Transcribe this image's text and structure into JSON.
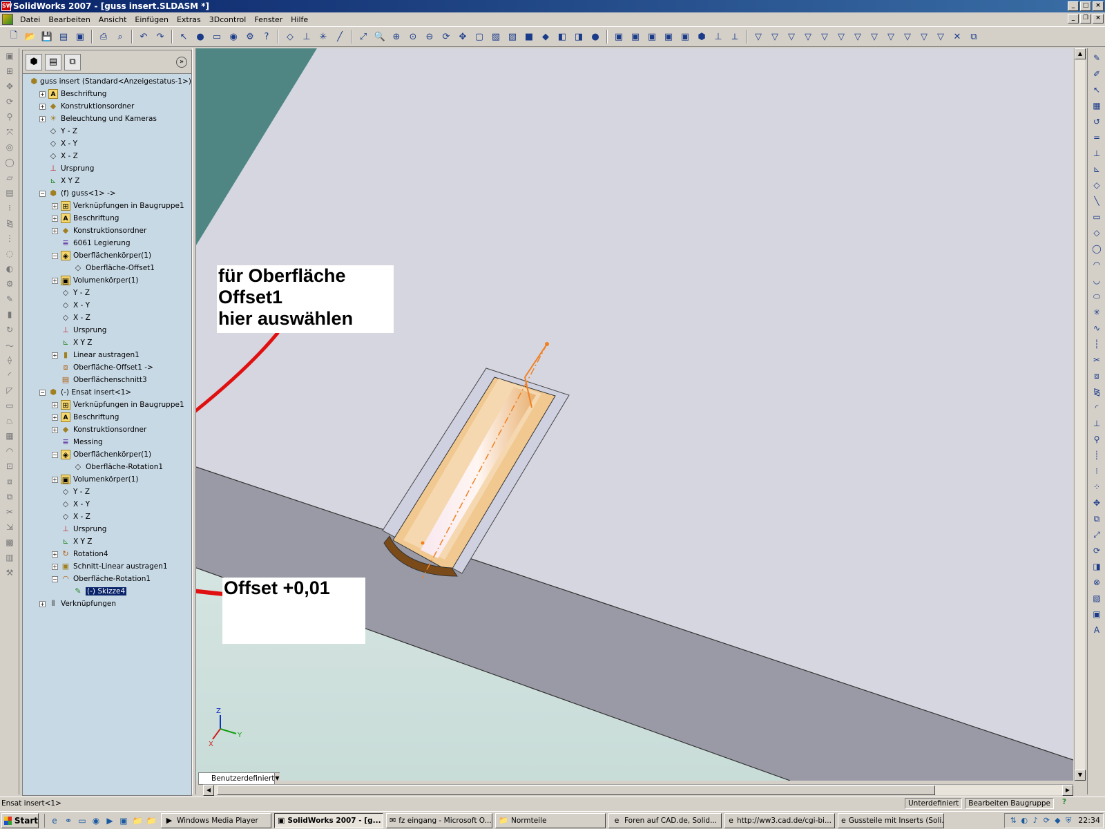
{
  "window": {
    "title": "SolidWorks 2007 - [guss insert.SLDASM *]",
    "app_icon_text": "SW"
  },
  "menu": [
    "Datei",
    "Bearbeiten",
    "Ansicht",
    "Einfügen",
    "Extras",
    "3Dcontrol",
    "Fenster",
    "Hilfe"
  ],
  "feature_tree": [
    {
      "label": "guss insert  (Standard<Anzeigestatus-1>)",
      "depth": 0,
      "toggle": "",
      "icon": "assembly-icon"
    },
    {
      "label": "Beschriftung",
      "depth": 1,
      "toggle": "+",
      "icon": "annotation-icon"
    },
    {
      "label": "Konstruktionsordner",
      "depth": 1,
      "toggle": "+",
      "icon": "design-folder-icon"
    },
    {
      "label": "Beleuchtung und Kameras",
      "depth": 1,
      "toggle": "+",
      "icon": "lights-icon"
    },
    {
      "label": "Y - Z",
      "depth": 1,
      "toggle": "",
      "icon": "plane-icon"
    },
    {
      "label": "X - Y",
      "depth": 1,
      "toggle": "",
      "icon": "plane-icon"
    },
    {
      "label": "X - Z",
      "depth": 1,
      "toggle": "",
      "icon": "plane-icon"
    },
    {
      "label": "Ursprung",
      "depth": 1,
      "toggle": "",
      "icon": "origin-icon"
    },
    {
      "label": "X Y Z",
      "depth": 1,
      "toggle": "",
      "icon": "coordinate-system-icon"
    },
    {
      "label": "(f) guss<1> ->",
      "depth": 1,
      "toggle": "-",
      "icon": "part-icon"
    },
    {
      "label": "Verknüpfungen in Baugruppe1",
      "depth": 2,
      "toggle": "+",
      "icon": "mates-folder-icon"
    },
    {
      "label": "Beschriftung",
      "depth": 2,
      "toggle": "+",
      "icon": "annotation-icon"
    },
    {
      "label": "Konstruktionsordner",
      "depth": 2,
      "toggle": "+",
      "icon": "design-folder-icon"
    },
    {
      "label": "6061 Legierung",
      "depth": 2,
      "toggle": "",
      "icon": "material-icon"
    },
    {
      "label": "Oberflächenkörper(1)",
      "depth": 2,
      "toggle": "-",
      "icon": "surface-bodies-icon"
    },
    {
      "label": "Oberfläche-Offset1",
      "depth": 3,
      "toggle": "",
      "icon": "surface-icon"
    },
    {
      "label": "Volumenkörper(1)",
      "depth": 2,
      "toggle": "+",
      "icon": "solid-bodies-icon"
    },
    {
      "label": "Y - Z",
      "depth": 2,
      "toggle": "",
      "icon": "plane-icon"
    },
    {
      "label": "X - Y",
      "depth": 2,
      "toggle": "",
      "icon": "plane-icon"
    },
    {
      "label": "X - Z",
      "depth": 2,
      "toggle": "",
      "icon": "plane-icon"
    },
    {
      "label": "Ursprung",
      "depth": 2,
      "toggle": "",
      "icon": "origin-icon"
    },
    {
      "label": "X Y Z",
      "depth": 2,
      "toggle": "",
      "icon": "coordinate-system-icon"
    },
    {
      "label": "Linear austragen1",
      "depth": 2,
      "toggle": "+",
      "icon": "extrude-icon"
    },
    {
      "label": "Oberfläche-Offset1 ->",
      "depth": 2,
      "toggle": "",
      "icon": "surface-offset-icon"
    },
    {
      "label": "Oberflächenschnitt3",
      "depth": 2,
      "toggle": "",
      "icon": "surface-cut-icon"
    },
    {
      "label": "(-) Ensat insert<1>",
      "depth": 1,
      "toggle": "-",
      "icon": "part-icon"
    },
    {
      "label": "Verknüpfungen in Baugruppe1",
      "depth": 2,
      "toggle": "+",
      "icon": "mates-folder-icon"
    },
    {
      "label": "Beschriftung",
      "depth": 2,
      "toggle": "+",
      "icon": "annotation-icon"
    },
    {
      "label": "Konstruktionsordner",
      "depth": 2,
      "toggle": "+",
      "icon": "design-folder-icon"
    },
    {
      "label": "Messing",
      "depth": 2,
      "toggle": "",
      "icon": "material-icon"
    },
    {
      "label": "Oberflächenkörper(1)",
      "depth": 2,
      "toggle": "-",
      "icon": "surface-bodies-icon"
    },
    {
      "label": "Oberfläche-Rotation1",
      "depth": 3,
      "toggle": "",
      "icon": "surface-icon"
    },
    {
      "label": "Volumenkörper(1)",
      "depth": 2,
      "toggle": "+",
      "icon": "solid-bodies-icon"
    },
    {
      "label": "Y - Z",
      "depth": 2,
      "toggle": "",
      "icon": "plane-icon"
    },
    {
      "label": "X - Y",
      "depth": 2,
      "toggle": "",
      "icon": "plane-icon"
    },
    {
      "label": "X - Z",
      "depth": 2,
      "toggle": "",
      "icon": "plane-icon"
    },
    {
      "label": "Ursprung",
      "depth": 2,
      "toggle": "",
      "icon": "origin-icon"
    },
    {
      "label": "X Y Z",
      "depth": 2,
      "toggle": "",
      "icon": "coordinate-system-icon"
    },
    {
      "label": "Rotation4",
      "depth": 2,
      "toggle": "+",
      "icon": "revolve-icon"
    },
    {
      "label": "Schnitt-Linear austragen1",
      "depth": 2,
      "toggle": "+",
      "icon": "cut-extrude-icon"
    },
    {
      "label": "Oberfläche-Rotation1",
      "depth": 2,
      "toggle": "-",
      "icon": "surface-revolve-icon"
    },
    {
      "label": "(-) Skizze4",
      "depth": 3,
      "toggle": "",
      "icon": "sketch-icon",
      "selected": true
    },
    {
      "label": "Verknüpfungen",
      "depth": 1,
      "toggle": "+",
      "icon": "mates-icon"
    }
  ],
  "annotations": {
    "callout1": [
      "für Oberfläche",
      "Offset1",
      "hier auswählen"
    ],
    "callout2": [
      "Offset +0,01"
    ],
    "arrow_color": "#e01010"
  },
  "viewport": {
    "configuration": "Benutzerdefiniert",
    "triad_labels": {
      "x": "X",
      "y": "Y",
      "z": "Z"
    }
  },
  "statusbar": {
    "left": "Ensat insert<1>",
    "state": "Unterdefiniert",
    "mode": "Bearbeiten Baugruppe"
  },
  "taskbar": {
    "start": "Start",
    "tasks": [
      {
        "label": "Windows Media Player",
        "icon": "media-player-icon",
        "active": false
      },
      {
        "label": "SolidWorks 2007 - [g...",
        "icon": "solidworks-icon",
        "active": true
      },
      {
        "label": "fz eingang - Microsoft O...",
        "icon": "outlook-icon",
        "active": false
      },
      {
        "label": "Normteile",
        "icon": "folder-icon",
        "active": false
      },
      {
        "label": "Foren auf CAD.de, Solid...",
        "icon": "browser-icon",
        "active": false
      },
      {
        "label": "http://ww3.cad.de/cgi-bi...",
        "icon": "browser-icon",
        "active": false
      },
      {
        "label": "Gussteile mit Inserts (Soli...",
        "icon": "browser-icon",
        "active": false
      }
    ],
    "clock": "22:34"
  },
  "colors": {
    "tree_bg": "#c8d9e6",
    "viewport_bg": "#d6d6e0",
    "part_face_gray": "#9a9aa6",
    "insert_brass": "#f0c890",
    "sketch_line": "#f08020"
  }
}
